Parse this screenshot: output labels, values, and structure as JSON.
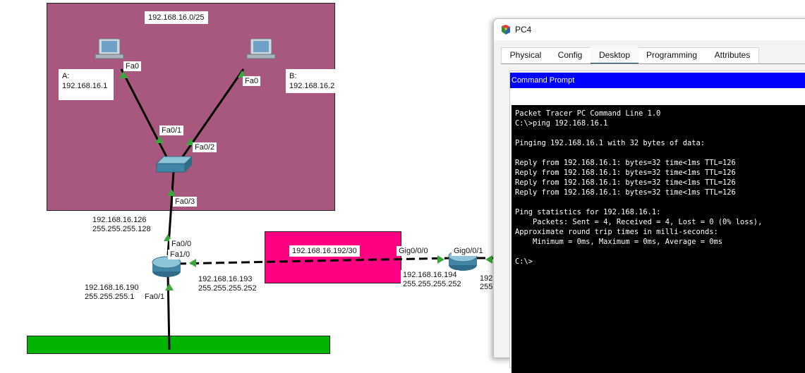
{
  "topology": {
    "lan_top": {
      "network": "192.168.16.0/25",
      "pc_a": {
        "name_line": "A:",
        "ip": "192.168.16.1",
        "port": "Fa0"
      },
      "pc_b": {
        "name_line": "B:",
        "ip": "192.168.16.2",
        "port": "Fa0"
      },
      "switch_ports": {
        "p1": "Fa0/1",
        "p2": "Fa0/2",
        "p3": "Fa0/3"
      }
    },
    "router1": {
      "fa00_ip": "192.168.16.126",
      "fa00_mask": "255.255.255.128",
      "fa00_label": "Fa0/0",
      "fa10_label": "Fa1/0",
      "fa10_ip": "192.168.16.193",
      "fa10_mask": "255.255.255.252",
      "fa01_ip": "192.168.16.190",
      "fa01_mask": "255.255.255.1",
      "fa01_label": "Fa0/1"
    },
    "wan_link": {
      "network": "192.168.16.192/30",
      "gig000_label": "Gig0/0/0",
      "gig001_label": "Gig0/0/1",
      "router2_ip": "192.168.16.194",
      "router2_mask": "255.255.255.252",
      "right_ip_partial": "192",
      "right_mask_partial": "255"
    },
    "colors": {
      "lan_zone": "#a8587e",
      "wan_zone": "#ff0080",
      "bottom_zone": "#00b400",
      "port_marker": "#3aa83a"
    }
  },
  "window": {
    "title": "PC4",
    "tabs": [
      {
        "label": "Physical",
        "active": false
      },
      {
        "label": "Config",
        "active": false
      },
      {
        "label": "Desktop",
        "active": true
      },
      {
        "label": "Programming",
        "active": false
      },
      {
        "label": "Attributes",
        "active": false
      }
    ],
    "app_title": "Command Prompt",
    "terminal_text": "Packet Tracer PC Command Line 1.0\nC:\\>ping 192.168.16.1\n\nPinging 192.168.16.1 with 32 bytes of data:\n\nReply from 192.168.16.1: bytes=32 time<1ms TTL=126\nReply from 192.168.16.1: bytes=32 time<1ms TTL=126\nReply from 192.168.16.1: bytes=32 time<1ms TTL=126\nReply from 192.168.16.1: bytes=32 time<1ms TTL=126\n\nPing statistics for 192.168.16.1:\n    Packets: Sent = 4, Received = 4, Lost = 0 (0% loss),\nApproximate round trip times in milli-seconds:\n    Minimum = 0ms, Maximum = 0ms, Average = 0ms\n\nC:\\>"
  }
}
